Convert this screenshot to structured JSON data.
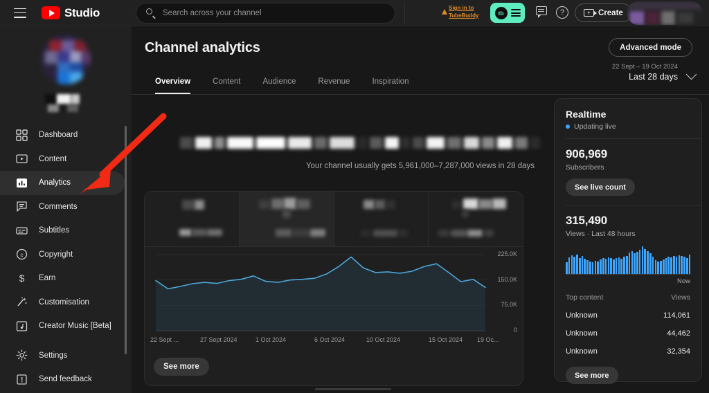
{
  "topbar": {
    "menu_icon": "hamburger-icon",
    "brand": "Studio",
    "search": {
      "placeholder": "Search across your channel",
      "value": "",
      "icon": "search-icon"
    },
    "tubebuddy_signin_line1": "Sign in to",
    "tubebuddy_signin_line2": "TubeBuddy",
    "tubebuddy_logo_text": "tb",
    "feedback_icon": "comment-icon",
    "help_icon": "help-circle-icon",
    "help_glyph": "?",
    "create_label": "Create",
    "create_icon": "video-plus-icon",
    "avatar": "user-avatar-blurred"
  },
  "sidebar": {
    "avatar": "channel-avatar-blurred",
    "channel_name": "blurred",
    "items": [
      {
        "label": "Dashboard",
        "icon": "dashboard-icon",
        "active": false
      },
      {
        "label": "Content",
        "icon": "content-video-icon",
        "active": false
      },
      {
        "label": "Analytics",
        "icon": "analytics-bar-icon",
        "active": true
      },
      {
        "label": "Comments",
        "icon": "comments-icon",
        "active": false
      },
      {
        "label": "Subtitles",
        "icon": "subtitles-icon",
        "active": false
      },
      {
        "label": "Copyright",
        "icon": "copyright-icon",
        "active": false
      },
      {
        "label": "Earn",
        "icon": "dollar-icon",
        "active": false
      },
      {
        "label": "Customisation",
        "icon": "magic-wand-icon",
        "active": false
      },
      {
        "label": "Creator Music [Beta]",
        "icon": "music-note-icon",
        "active": false
      },
      {
        "label": "Settings",
        "icon": "gear-icon",
        "active": false
      },
      {
        "label": "Send feedback",
        "icon": "feedback-icon",
        "active": false
      }
    ]
  },
  "main": {
    "page_title": "Channel analytics",
    "advanced_mode_label": "Advanced mode",
    "date_range": {
      "range": "22 Sept – 19 Oct 2024",
      "preset": "Last 28 days"
    },
    "tabs": [
      {
        "label": "Overview",
        "active": true
      },
      {
        "label": "Content",
        "active": false
      },
      {
        "label": "Audience",
        "active": false
      },
      {
        "label": "Revenue",
        "active": false
      },
      {
        "label": "Inspiration",
        "active": false
      }
    ],
    "usually_text": "Your channel usually gets 5,961,000–7,287,000 views in 28 days",
    "see_more_label": "See more",
    "metric_tiles": [
      {
        "selected": false
      },
      {
        "selected": true
      },
      {
        "selected": false
      },
      {
        "selected": false
      }
    ]
  },
  "chart_data": {
    "type": "line",
    "title": "",
    "xlabel": "",
    "ylabel": "",
    "ylim": [
      0,
      225000
    ],
    "yticks": [
      0,
      75000,
      150000,
      225000
    ],
    "ytick_labels": [
      "0",
      "75.0K",
      "150.0K",
      "225.0K"
    ],
    "grid": true,
    "legend": "none",
    "line_color": "#4da6d8",
    "fill": true,
    "xtick_labels": [
      "22 Sept ...",
      "27 Sept 2024",
      "1 Oct 2024",
      "6 Oct 2024",
      "10 Oct 2024",
      "15 Oct 2024",
      "19 Oc..."
    ],
    "x": [
      "22 Sept",
      "23 Sept",
      "24 Sept",
      "25 Sept",
      "26 Sept",
      "27 Sept",
      "28 Sept",
      "29 Sept",
      "30 Sept",
      "1 Oct",
      "2 Oct",
      "3 Oct",
      "4 Oct",
      "5 Oct",
      "6 Oct",
      "7 Oct",
      "8 Oct",
      "9 Oct",
      "10 Oct",
      "11 Oct",
      "12 Oct",
      "13 Oct",
      "14 Oct",
      "15 Oct",
      "16 Oct",
      "17 Oct",
      "18 Oct",
      "19 Oct"
    ],
    "values": [
      148000,
      124000,
      131000,
      139000,
      143000,
      140000,
      148000,
      152000,
      162000,
      146000,
      143000,
      150000,
      152000,
      155000,
      168000,
      190000,
      218000,
      186000,
      172000,
      174000,
      170000,
      176000,
      190000,
      198000,
      172000,
      145000,
      152000,
      128000
    ],
    "series": [
      {
        "name": "Views",
        "values": [
          148000,
          124000,
          131000,
          139000,
          143000,
          140000,
          148000,
          152000,
          162000,
          146000,
          143000,
          150000,
          152000,
          155000,
          168000,
          190000,
          218000,
          186000,
          172000,
          174000,
          170000,
          176000,
          190000,
          198000,
          172000,
          145000,
          152000,
          128000
        ]
      }
    ]
  },
  "realtime": {
    "title": "Realtime",
    "live_status": "Updating live",
    "subscribers_count": "906,969",
    "subscribers_label": "Subscribers",
    "see_live_count_label": "See live count",
    "views_count": "315,490",
    "views_label": "Views · Last 48 hours",
    "now_label": "Now",
    "sparkline": [
      38,
      52,
      60,
      55,
      62,
      50,
      58,
      48,
      44,
      40,
      38,
      42,
      40,
      46,
      50,
      48,
      52,
      50,
      46,
      50,
      52,
      48,
      54,
      58,
      68,
      72,
      66,
      70,
      78,
      88,
      80,
      72,
      66,
      56,
      44,
      40,
      42,
      46,
      50,
      54,
      52,
      58,
      56,
      60,
      58,
      54,
      50,
      62
    ],
    "top_content_header": "Top content",
    "views_header": "Views",
    "rows": [
      {
        "title": "Unknown",
        "views": "114,061"
      },
      {
        "title": "Unknown",
        "views": "44,462"
      },
      {
        "title": "Unknown",
        "views": "32,354"
      }
    ],
    "see_more_label": "See more"
  },
  "annotation": {
    "arrow_color": "#f02a14",
    "points_to": "Analytics"
  },
  "colors": {
    "accent_blue": "#3ea6ff",
    "chart_line": "#4da6d8",
    "youtube_red": "#ff0000",
    "tubebuddy_teal": "#5fedc0",
    "tubebuddy_orange": "#e08c2c",
    "bg": "#181818",
    "panel": "#1f1f1f",
    "sidebar_bg": "#212121"
  }
}
